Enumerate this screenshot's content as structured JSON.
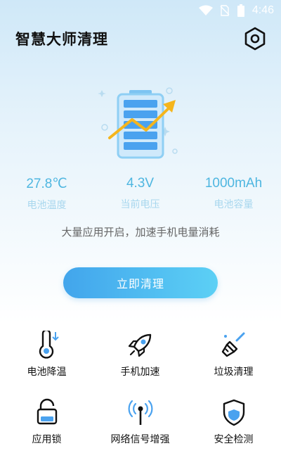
{
  "status_bar": {
    "time": "4:46"
  },
  "header": {
    "title": "智慧大师清理"
  },
  "stats": [
    {
      "value": "27.8℃",
      "label": "电池温度"
    },
    {
      "value": "4.3V",
      "label": "当前电压"
    },
    {
      "value": "1000mAh",
      "label": "电池容量"
    }
  ],
  "notice": "大量应用开启，加速手机电量消耗",
  "clean_button": {
    "label": "立即清理"
  },
  "tools": [
    {
      "label": "电池降温",
      "icon": "thermometer-icon"
    },
    {
      "label": "手机加速",
      "icon": "rocket-icon"
    },
    {
      "label": "垃圾清理",
      "icon": "broom-icon"
    },
    {
      "label": "应用锁",
      "icon": "lock-icon"
    },
    {
      "label": "网络信号增强",
      "icon": "antenna-icon"
    },
    {
      "label": "安全检测",
      "icon": "shield-icon"
    }
  ],
  "colors": {
    "accent": "#4eb6e0",
    "button_start": "#42a5ec",
    "button_end": "#5cd0f5",
    "label_light": "#a8d7ee"
  }
}
